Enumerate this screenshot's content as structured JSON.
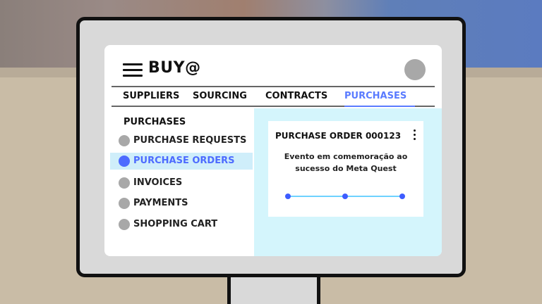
{
  "app": {
    "title": "BUY@"
  },
  "tabs": [
    {
      "label": "SUPPLIERS"
    },
    {
      "label": "SOURCING"
    },
    {
      "label": "CONTRACTS"
    },
    {
      "label": "PURCHASES",
      "active": true
    }
  ],
  "sidebar": {
    "heading": "PURCHASES",
    "items": [
      {
        "label": "PURCHASE REQUESTS"
      },
      {
        "label": "PURCHASE ORDERS",
        "active": true
      },
      {
        "label": "INVOICES"
      },
      {
        "label": "PAYMENTS"
      },
      {
        "label": "SHOPPING CART"
      }
    ]
  },
  "card": {
    "title": "PURCHASE ORDER 000123",
    "description_line1": "Evento em comemoração ao",
    "description_line2": "sucesso do Meta Quest"
  },
  "colors": {
    "accent": "#5a7bff",
    "panel": "#d4f5fc",
    "progress_line": "#6ed2ff",
    "progress_node": "#3d5cff"
  },
  "icons": {
    "menu": "hamburger-menu-icon",
    "avatar": "avatar",
    "more": "kebab-menu-icon"
  }
}
